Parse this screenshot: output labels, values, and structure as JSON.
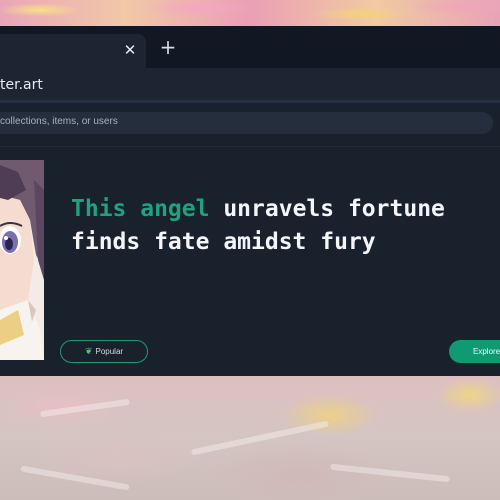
{
  "browser": {
    "tab_close_glyph": "✕",
    "new_tab_glyph": "+",
    "address": "ter.art"
  },
  "search": {
    "placeholder": "collections, items, or users"
  },
  "hero": {
    "headline_accent": "This angel",
    "headline_rest": " unravels fortune",
    "headline_line2": "finds fate amidst fury",
    "popular_icon": "leaf-icon",
    "popular_label": "Popular",
    "explore_label": "Explore"
  },
  "colors": {
    "accent": "#1fa37c",
    "button": "#0f9a72",
    "background": "#19212d"
  }
}
